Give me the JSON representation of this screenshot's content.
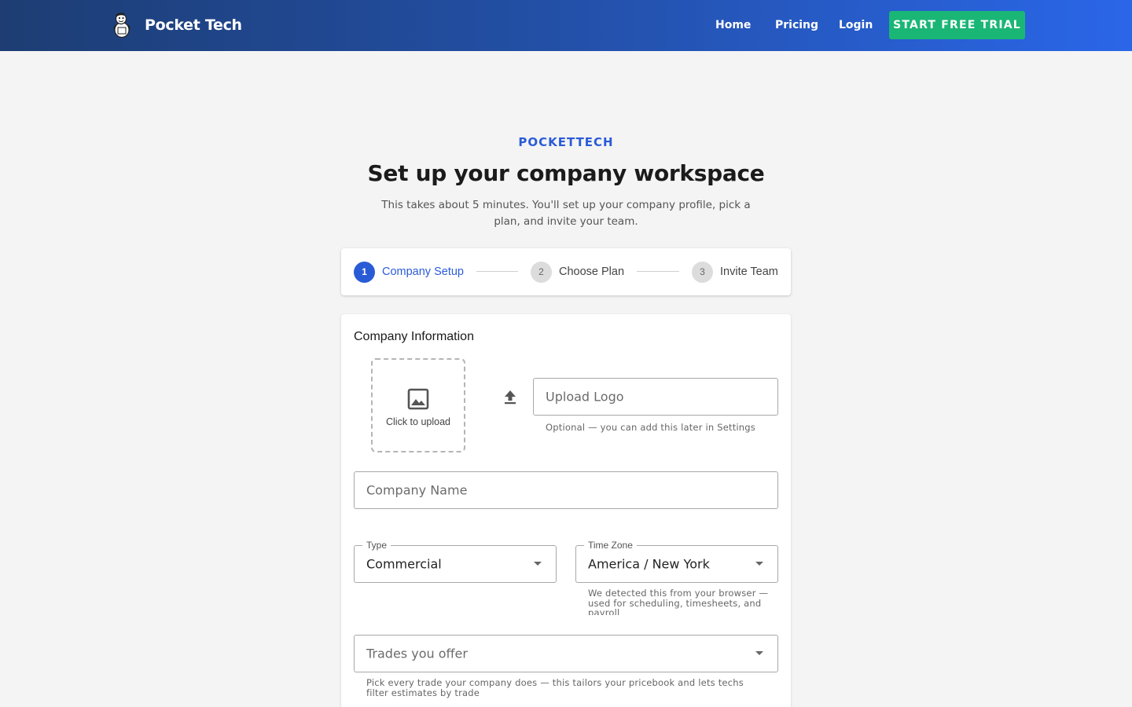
{
  "header": {
    "brand_name": "Pocket Tech",
    "nav": {
      "home": "Home",
      "pricing": "Pricing",
      "login": "Login"
    },
    "cta_label": "START FREE TRIAL"
  },
  "hero": {
    "eyebrow": "POCKETTECH",
    "title": "Set up your company workspace",
    "subtitle": "This takes about 5 minutes. You'll set up your company profile, pick a plan, and invite your team."
  },
  "stepper": {
    "steps": [
      {
        "number": "1",
        "label": "Company Setup",
        "state": "active"
      },
      {
        "number": "2",
        "label": "Choose Plan",
        "state": "inactive"
      },
      {
        "number": "3",
        "label": "Invite Team",
        "state": "inactive"
      }
    ]
  },
  "form": {
    "section_title": "Company Information",
    "upload_box_text": "Click to upload",
    "upload_logo_placeholder": "Upload Logo",
    "upload_logo_helper": "Optional — you can add this later in Settings",
    "company_name_placeholder": "Company Name",
    "type": {
      "legend": "Type",
      "value": "Commercial"
    },
    "time_zone": {
      "legend": "Time Zone",
      "value": "America / New York",
      "helper": "We detected this from your browser — used for scheduling, timesheets, and payroll"
    },
    "trades": {
      "placeholder": "Trades you offer",
      "helper": "Pick every trade your company does — this tailors your pricebook and lets techs filter estimates by trade"
    }
  },
  "colors": {
    "header_gradient_start": "#1d3d73",
    "header_gradient_end": "#2a66e8",
    "cta": "#1ab676",
    "accent": "#2a5bd7"
  },
  "icons": [
    "mascot-logo-icon",
    "image-icon",
    "upload-arrow-icon",
    "dropdown-caret-icon"
  ]
}
